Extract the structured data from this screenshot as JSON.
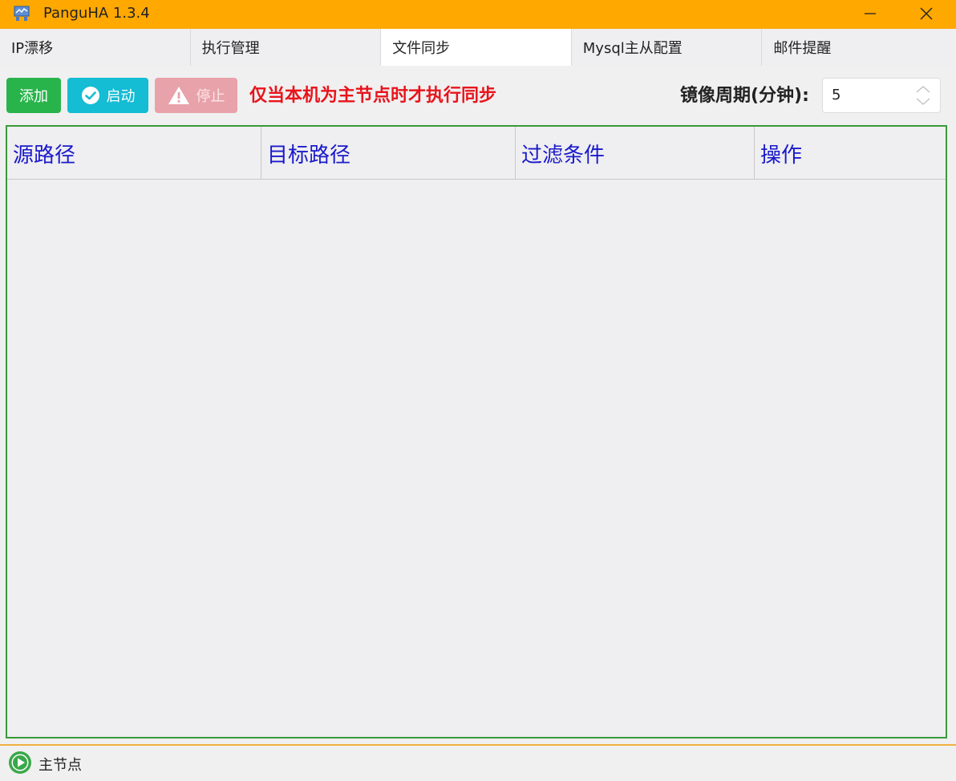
{
  "window": {
    "title": "PanguHA 1.3.4",
    "icon": "app-logo-icon",
    "accent": "#ffa800"
  },
  "tabs": [
    {
      "label": "IP漂移",
      "active": false
    },
    {
      "label": "执行管理",
      "active": false
    },
    {
      "label": "文件同步",
      "active": true
    },
    {
      "label": "Mysql主从配置",
      "active": false
    },
    {
      "label": "邮件提醒",
      "active": false
    }
  ],
  "toolbar": {
    "add_label": "添加",
    "start_label": "启动",
    "stop_label": "停止",
    "notice": "仅当本机为主节点时才执行同步",
    "period_label": "镜像周期(分钟):",
    "period_value": "5"
  },
  "table": {
    "columns": [
      "源路径",
      "目标路径",
      "过滤条件",
      "操作"
    ],
    "rows": []
  },
  "status": {
    "text": "主节点",
    "icon": "play-circle-icon"
  }
}
